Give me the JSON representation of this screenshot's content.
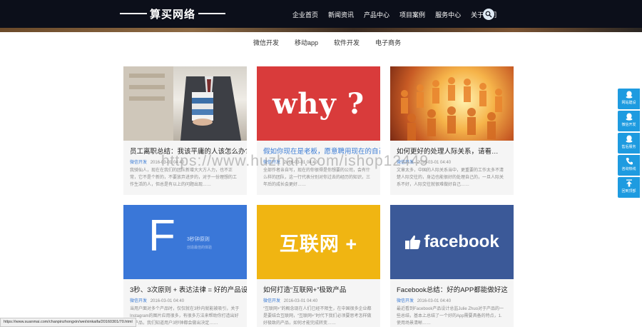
{
  "header": {
    "logo_text": "算买网络",
    "nav": [
      "企业首页",
      "新闻资讯",
      "产品中心",
      "项目案例",
      "服务中心",
      "关于我们"
    ]
  },
  "subnav": [
    "微信开发",
    "移动app",
    "软件开发",
    "电子商务"
  ],
  "cards": [
    {
      "title": "员工离职总结：我该平庸的人该怎么办?",
      "tag": "微信开发",
      "date": "2016-03-01 04:40",
      "excerpt": "我骑仙人，现在在我们的团队新增大大方人力，也不正常，它不是个新的，不要放弃进步的，对于一份理想的工作生活的人，但总是有以上的问题出现……"
    },
    {
      "title": "假如你现在是老板，愿意聘用现在的自己",
      "tag": "微信开发",
      "date": "2016-03-01 04:40",
      "image_text": "why ?",
      "excerpt": "全部作者亲自写，现在的你很得是你想要的公司，会有什么样的团队，这一行代表分别对你过去的经历的知识，三年后的成长会更好……"
    },
    {
      "title": "如何更好的处理人际关系，请看…",
      "tag": "微信开发",
      "date": "2016-03-01 04:40",
      "excerpt": "文章太多，中国的人际关系当中，更重要的工作太多不清楚人际交往的，身边也能很好的处理自己的，一旦人际关系不好，人际交往就很难做好自己……"
    },
    {
      "title": "3秒、3次原则 + 表达法律 = 好的产品设",
      "tag": "微信开发",
      "date": "2016-03-01 04:40",
      "image_text": "F",
      "image_sub1": "3秒钟原则",
      "image_sub2": "创造最佳的体验",
      "excerpt": "当用户面对多个产品时，仅仅就在3秒内就能被吸引，关于Instagram的图片应用很多，有很多方法来帮助你打造出好的产品，我们知道用户3秒钟都会做出决定……"
    },
    {
      "title": "如何打造“互联网+”极致产品",
      "tag": "微信开发",
      "date": "2016-03-01 04:40",
      "image_text": "互联网 +",
      "excerpt": "“互联网+”的概念现在人们已经不陌生，在中国很多企业都是要结合互联网，“互联网+”时代下我们必须要思考怎样做好极致的产品，如何才能完成转变……"
    },
    {
      "title": "Facebook总结：好的APP都能做好这",
      "tag": "微信开发",
      "date": "2016-03-01 04:40",
      "image_text": "facebook",
      "excerpt": "最近看到Facebook产品设计总监Julie Zhuo对于产品的一些总结，基本上总结了一个好的App需要具备的特点，1. 使用场景清晰……"
    }
  ],
  "right_float": [
    "网站建设",
    "微信开发",
    "售后服务",
    "咨询热线",
    "回到顶部"
  ],
  "watermark": "https://www.huzhan.com/ishop12449",
  "status_url": "https://www.suanmai.com/chanpinzhongxin/wei/xinkaifa/20160301/70.html",
  "colors": {
    "topbar": "#0c0f1a",
    "accent_blue": "#1e9be0",
    "card_red": "#d93b3b",
    "card_blue": "#3a77d8",
    "card_yellow": "#f0b512",
    "card_facebook": "#3b5998"
  }
}
